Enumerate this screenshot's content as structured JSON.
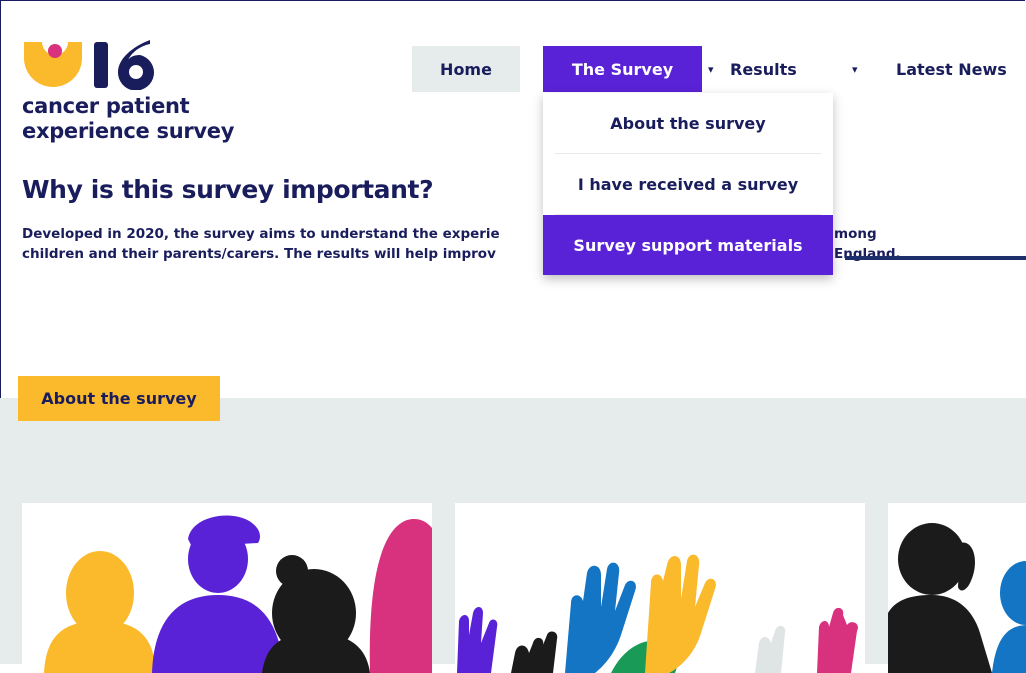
{
  "logo": {
    "number": "16",
    "line1": "cancer patient",
    "line2": "experience survey",
    "colors": {
      "yellow": "#fbb92c",
      "pink": "#d8317e",
      "navy": "#1a1d5c"
    }
  },
  "nav": {
    "items": [
      {
        "label": "Home"
      },
      {
        "label": "The Survey"
      },
      {
        "label": "Results"
      },
      {
        "label": "Latest News"
      }
    ],
    "caret": "▾"
  },
  "dropdown": {
    "items": [
      {
        "label": "About the survey"
      },
      {
        "label": "I have received a survey"
      },
      {
        "label": "Survey support materials"
      }
    ]
  },
  "main": {
    "headline": "Why is this survey important?",
    "para_line1": "Developed in 2020, the survey aims to understand the experie",
    "para_line2": "children and their parents/carers. The results will help improv",
    "para_right_line1": "mong",
    "para_right_line2": "England."
  },
  "section": {
    "tag": "About the survey"
  },
  "colors": {
    "accent": "#5a22d6",
    "navy": "#1a1d5c",
    "grey": "#e6ebeb",
    "yellow": "#fbb92c",
    "pink": "#d8317e",
    "blue": "#1475c4",
    "green": "#1a9a57",
    "black": "#1b1b1b"
  }
}
